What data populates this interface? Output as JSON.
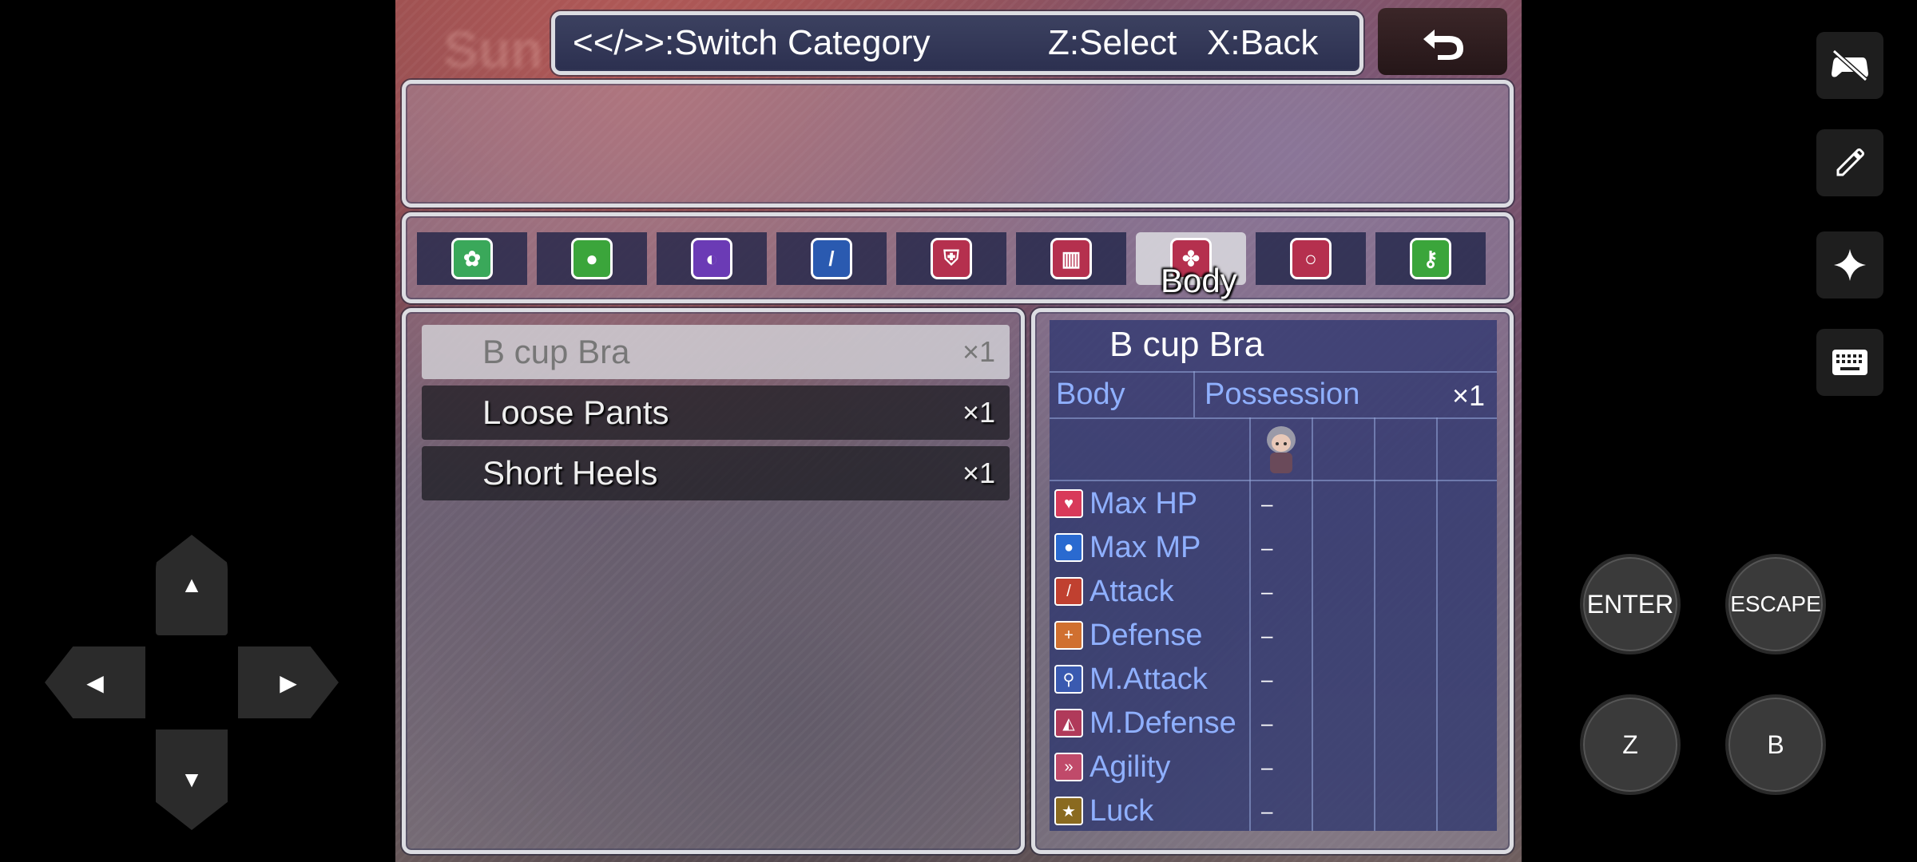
{
  "header": {
    "switch_hint": "<</>>:Switch Category",
    "select_hint": "Z:Select",
    "back_hint": "X:Back"
  },
  "categories": [
    {
      "icon": "bag-icon",
      "color": "#3aa85a"
    },
    {
      "icon": "bomb-icon",
      "color": "#3ba53b"
    },
    {
      "icon": "orb-icon",
      "color": "#6b3bb5"
    },
    {
      "icon": "sword-icon",
      "color": "#2a5ab0"
    },
    {
      "icon": "shield-icon",
      "color": "#b5304e"
    },
    {
      "icon": "armor-icon",
      "color": "#b5304e"
    },
    {
      "icon": "body-icon",
      "color": "#b5304e"
    },
    {
      "icon": "ring-icon",
      "color": "#b5304e"
    },
    {
      "icon": "key-icon",
      "color": "#3ba53b"
    }
  ],
  "selected_category": "Body",
  "items": [
    {
      "name": "B cup Bra",
      "qty": "×1"
    },
    {
      "name": "Loose Pants",
      "qty": "×1"
    },
    {
      "name": "Short Heels",
      "qty": "×1"
    }
  ],
  "detail": {
    "name": "B cup Bra",
    "type": "Body",
    "possession_label": "Possession",
    "possession_qty": "×1",
    "stats": [
      {
        "name": "Max HP",
        "value": "–",
        "icon": "heart-icon",
        "color": "#d83a5a"
      },
      {
        "name": "Max MP",
        "value": "–",
        "icon": "mana-orb-icon",
        "color": "#2a6ad0"
      },
      {
        "name": "Attack",
        "value": "–",
        "icon": "attack-icon",
        "color": "#c04030"
      },
      {
        "name": "Defense",
        "value": "–",
        "icon": "defense-icon",
        "color": "#d07030"
      },
      {
        "name": "M.Attack",
        "value": "–",
        "icon": "magic-attack-icon",
        "color": "#3a5ab0"
      },
      {
        "name": "M.Defense",
        "value": "–",
        "icon": "magic-defense-icon",
        "color": "#b03a5a"
      },
      {
        "name": "Agility",
        "value": "–",
        "icon": "agility-icon",
        "color": "#c04a6a"
      },
      {
        "name": "Luck",
        "value": "–",
        "icon": "luck-icon",
        "color": "#8a6a20"
      }
    ]
  },
  "controls": {
    "enter": "ENTER",
    "escape": "ESCAPE",
    "z": "Z",
    "b": "B",
    "up": "▲",
    "down": "▼",
    "left": "◀",
    "right": "▶"
  }
}
